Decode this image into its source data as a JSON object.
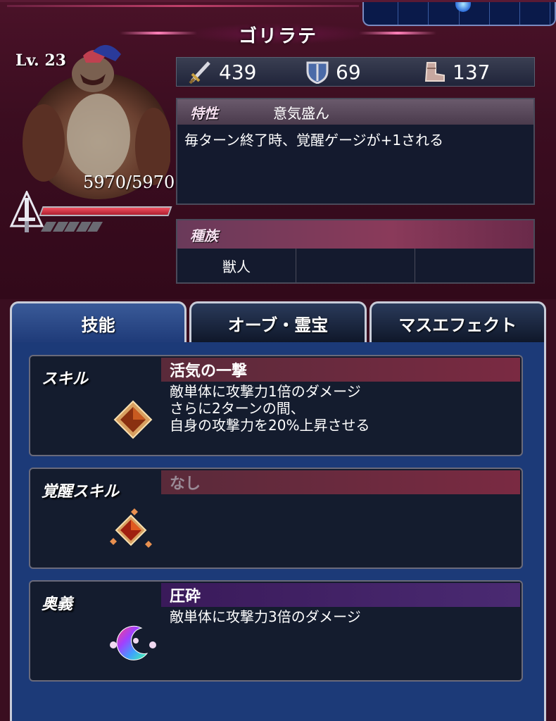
{
  "monster": {
    "name": "ゴリラテ",
    "level": "Lv. 23",
    "hp": "5970/5970",
    "hp_fraction": 1.0
  },
  "stats": {
    "attack": "439",
    "defense": "69",
    "speed": "137"
  },
  "trait": {
    "label": "特性",
    "name": "意気盛ん",
    "description": "毎ターン終了時、覚醒ゲージが+1される"
  },
  "race": {
    "label": "種族",
    "values": [
      "獣人",
      "",
      ""
    ]
  },
  "tabs": [
    {
      "label": "技能",
      "active": true
    },
    {
      "label": "オーブ・霊宝",
      "active": false
    },
    {
      "label": "マスエフェクト",
      "active": false
    }
  ],
  "skills": [
    {
      "type": "スキル",
      "name": "活気の一撃",
      "desc": [
        "敵単体に攻撃力1倍のダメージ",
        "さらに2ターンの間、",
        "自身の攻撃力を20%上昇させる"
      ],
      "icon": "skill-crystal-icon"
    },
    {
      "type": "覚醒スキル",
      "name": "なし",
      "desc": [],
      "icon": "awakening-crystal-icon"
    },
    {
      "type": "奥義",
      "name": "圧砕",
      "desc": [
        "敵単体に攻撃力3倍のダメージ"
      ],
      "icon": "ougi-crescent-icon"
    }
  ],
  "colors": {
    "panel_bg": "#3a0e20",
    "skill_bar_red": "#7a2a42",
    "skill_bar_purple": "#4a2a72",
    "content_blue": "#1c3a78"
  }
}
